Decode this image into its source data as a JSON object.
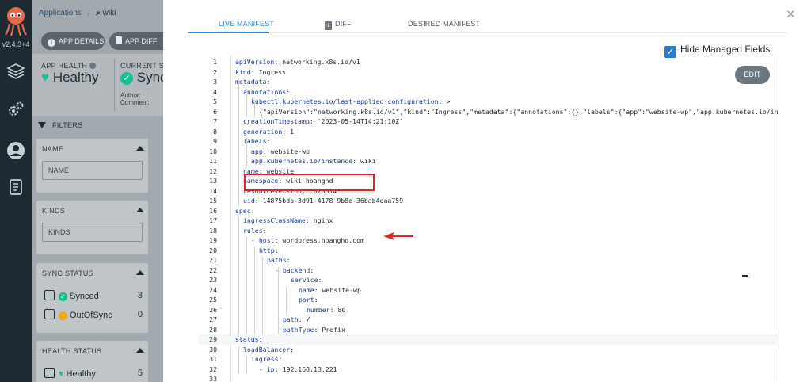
{
  "nav": {
    "version": "v2.4.3+4"
  },
  "app": {
    "breadcrumb": {
      "root": "Applications",
      "separator": "/",
      "current": "wiki"
    },
    "buttons": {
      "details": "APP DETAILS",
      "diff": "APP DIFF"
    },
    "health": {
      "header": "APP HEALTH",
      "value": "Healthy"
    },
    "sync": {
      "header": "CURRENT SYNC",
      "value": "Synced",
      "author_label": "Author:",
      "comment_label": "Comment:"
    },
    "filters_label": "FILTERS",
    "name_filter": {
      "title": "NAME",
      "placeholder": "NAME"
    },
    "kinds_filter": {
      "title": "KINDS",
      "placeholder": "KINDS"
    },
    "sync_status": {
      "title": "SYNC STATUS",
      "items": [
        {
          "label": "Synced",
          "count": "3"
        },
        {
          "label": "OutOfSync",
          "count": "0"
        }
      ]
    },
    "health_status": {
      "title": "HEALTH STATUS",
      "items": [
        {
          "label": "Healthy",
          "count": "5"
        }
      ]
    }
  },
  "modal": {
    "tabs": [
      "LIVE MANIFEST",
      "DIFF",
      "DESIRED MANIFEST"
    ],
    "active_tab": "LIVE MANIFEST",
    "hide_managed_fields": {
      "label": "Hide Managed Fields",
      "checked": true
    },
    "edit_label": "EDIT",
    "manifest": [
      {
        "n": "1",
        "key": "apiVersion",
        "val": " networking.k8s.io/v1",
        "indent": 0
      },
      {
        "n": "2",
        "key": "kind",
        "val": " Ingress",
        "indent": 0
      },
      {
        "n": "3",
        "key": "metadata",
        "val": "",
        "indent": 0
      },
      {
        "n": "4",
        "key": "annotations",
        "val": "",
        "indent": 1
      },
      {
        "n": "5",
        "key": "kubectl.kubernetes.io/last-applied-configuration",
        "val": " >",
        "indent": 2
      },
      {
        "n": "6",
        "key": "",
        "val": "{\"apiVersion\":\"networking.k8s.io/v1\",\"kind\":\"Ingress\",\"metadata\":{\"annotations\":{},\"labels\":{\"app\":\"website-wp\",\"app.kubernetes.io/in",
        "indent": 3
      },
      {
        "n": "7",
        "key": "creationTimestamp",
        "val": " '2023-05-14T14:21:10Z'",
        "indent": 1
      },
      {
        "n": "8",
        "key": "generation",
        "val": " 1",
        "indent": 1
      },
      {
        "n": "9",
        "key": "labels",
        "val": "",
        "indent": 1
      },
      {
        "n": "10",
        "key": "app",
        "val": " website-wp",
        "indent": 2
      },
      {
        "n": "11",
        "key": "app.kubernetes.io/instance",
        "val": " wiki",
        "indent": 2
      },
      {
        "n": "12",
        "key": "name",
        "val": " website",
        "indent": 1
      },
      {
        "n": "13",
        "key": "namespace",
        "val": " wiki-hoanghd",
        "indent": 1
      },
      {
        "n": "14",
        "key": "resourceVersion",
        "val": " '820814'",
        "indent": 1
      },
      {
        "n": "15",
        "key": "uid",
        "val": " 14875bdb-3d91-4178-9b8e-36bab4eaa759",
        "indent": 1
      },
      {
        "n": "16",
        "key": "spec",
        "val": "",
        "indent": 0
      },
      {
        "n": "17",
        "key": "ingressClassName",
        "val": " nginx",
        "indent": 1
      },
      {
        "n": "18",
        "key": "rules",
        "val": "",
        "indent": 1
      },
      {
        "n": "19",
        "key": "- host",
        "val": " wordpress.hoanghd.com",
        "indent": 2
      },
      {
        "n": "20",
        "key": "http",
        "val": "",
        "indent": 3
      },
      {
        "n": "21",
        "key": "paths",
        "val": "",
        "indent": 4
      },
      {
        "n": "22",
        "key": "- backend",
        "val": "",
        "indent": 5
      },
      {
        "n": "23",
        "key": "service",
        "val": "",
        "indent": 7
      },
      {
        "n": "24",
        "key": "name",
        "val": " website-wp",
        "indent": 8
      },
      {
        "n": "25",
        "key": "port",
        "val": "",
        "indent": 8
      },
      {
        "n": "26",
        "key": "number",
        "val": " 80",
        "indent": 9
      },
      {
        "n": "27",
        "key": "path",
        "val": " /",
        "indent": 6
      },
      {
        "n": "28",
        "key": "pathType",
        "val": " Prefix",
        "indent": 6
      },
      {
        "n": "29",
        "key": "status",
        "val": "",
        "indent": 0
      },
      {
        "n": "30",
        "key": "loadBalancer",
        "val": "",
        "indent": 1
      },
      {
        "n": "31",
        "key": "ingress",
        "val": "",
        "indent": 2
      },
      {
        "n": "32",
        "key": "- ip",
        "val": " 192.168.13.221",
        "indent": 3
      },
      {
        "n": "33",
        "key": "",
        "val": "",
        "indent": 0
      }
    ]
  },
  "colors": {
    "accent": "#2c8bd0",
    "healthy": "#18be94",
    "highlight": "#e02828"
  }
}
